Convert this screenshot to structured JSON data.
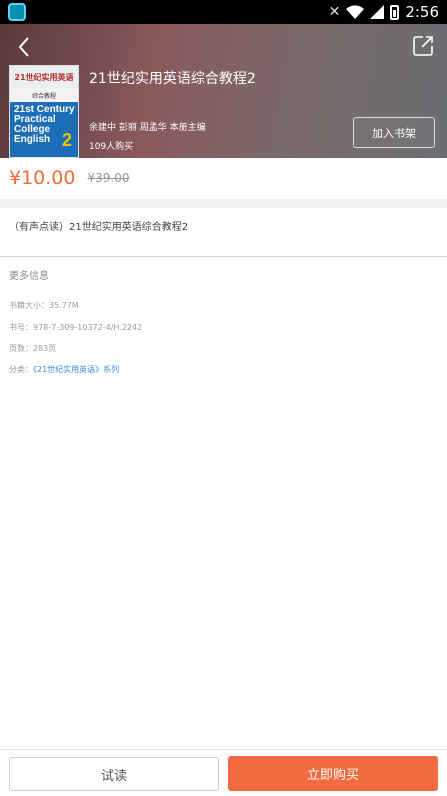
{
  "status_bar": {
    "time": "2:56",
    "app_icon": "app-icon",
    "icons": [
      "mute-icon",
      "wifi-icon",
      "signal-icon",
      "battery-icon"
    ]
  },
  "header": {
    "back_icon": "chevron-left-icon",
    "share_icon": "share-icon",
    "book_title": "21世纪实用英语综合教程2",
    "authors": "余建中 彭丽 周孟华 本册主编",
    "buyers": "109人购买",
    "add_shelf_label": "加入书架",
    "cover": {
      "top_text": "21世纪实用英语",
      "sub_text": "综合教程",
      "english_title": [
        "21st Century",
        "Practical",
        "College",
        "English"
      ],
      "number": "2"
    }
  },
  "price": {
    "current": "¥10.00",
    "original": "¥39.00"
  },
  "description": "（有声点读）21世纪实用英语综合教程2",
  "more_info": {
    "title": "更多信息",
    "size": "书籍大小：35.77M",
    "isbn": "书号：978-7-309-10372-4/H.2242",
    "pages": "页数：283页",
    "category_prefix": "分类：",
    "category_link": "《21世纪实用英语》系列"
  },
  "actions": {
    "try_label": "试读",
    "buy_label": "立即购买"
  },
  "colors": {
    "accent": "#f26a3f",
    "link": "#3a8fd6"
  }
}
